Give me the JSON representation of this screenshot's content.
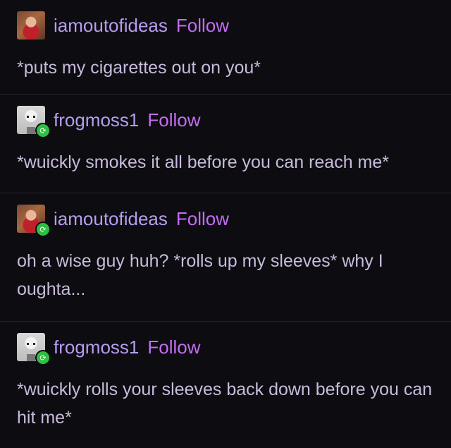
{
  "posts": [
    {
      "username": "iamoutofideas",
      "follow_label": "Follow",
      "text": "*puts my cigarettes out on you*"
    },
    {
      "username": "frogmoss1",
      "follow_label": "Follow",
      "text": "*wuickly smokes it all before you can reach me*"
    },
    {
      "username": "iamoutofideas",
      "follow_label": "Follow",
      "text": "oh a wise guy huh? *rolls up my sleeves* why I oughta..."
    },
    {
      "username": "frogmoss1",
      "follow_label": "Follow",
      "text": "*wuickly rolls your sleeves back down before you can hit me*"
    }
  ],
  "icons": {
    "reblog": "reblog-icon"
  },
  "colors": {
    "background": "#0d0c10",
    "username": "#b79df0",
    "follow": "#c56cf6",
    "text": "#c7bbdb",
    "reblog_badge": "#2fbf43"
  }
}
